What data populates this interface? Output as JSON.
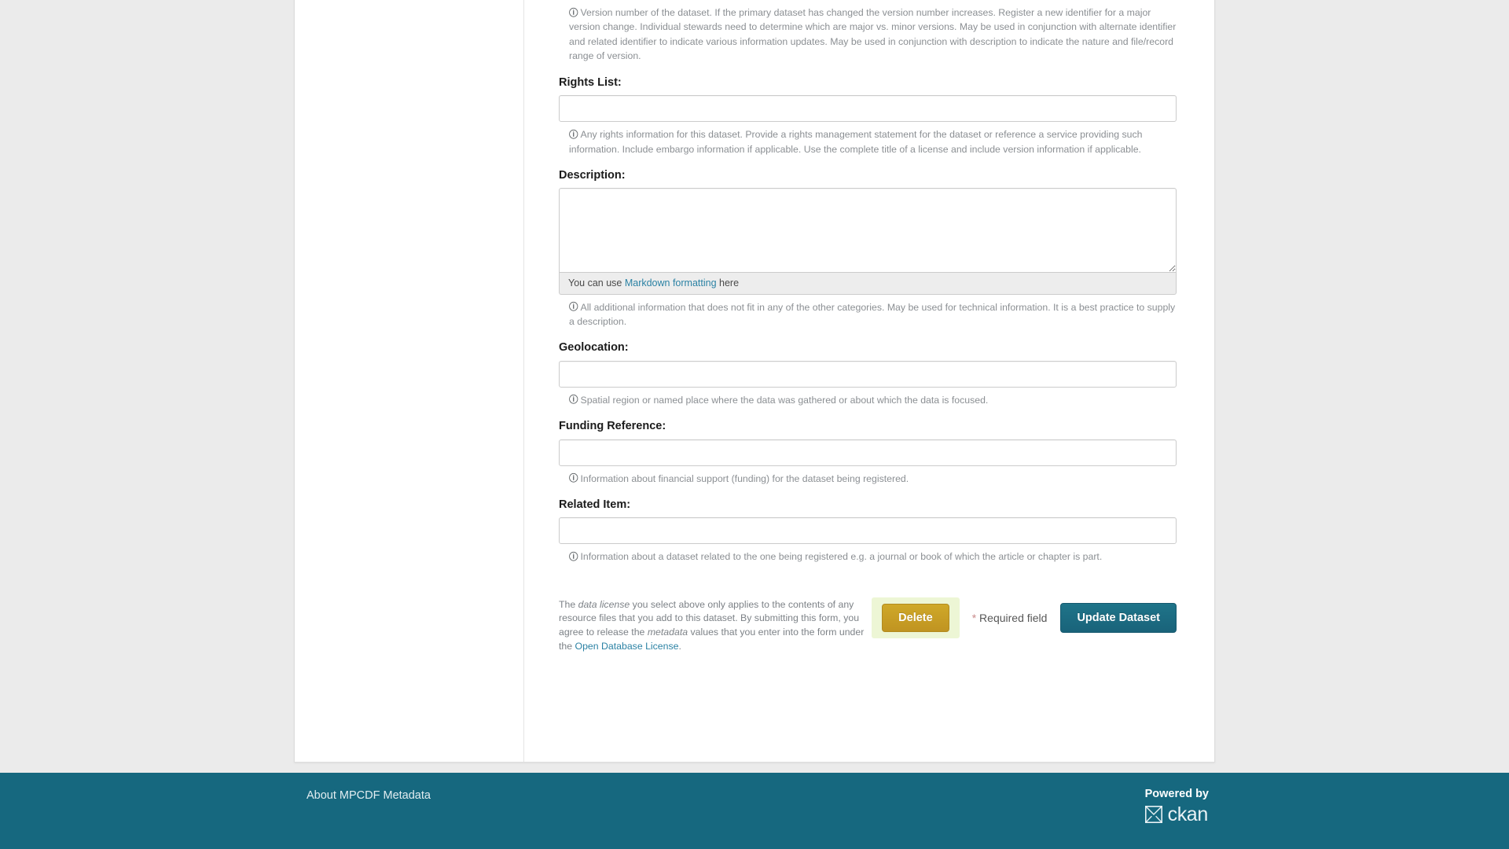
{
  "form": {
    "fields": [
      {
        "key": "version",
        "label": "",
        "value": "",
        "placeholder": "",
        "help": "Version number of the dataset. If the primary dataset has changed the version number increases. Register a new identifier for a major version change. Individual stewards need to determine which are major vs. minor versions. May be used in conjunction with alternate identifier and related identifier to indicate various information updates. May be used in conjunction with description to indicate the nature and file/record range of version."
      },
      {
        "key": "rights_list",
        "label": "Rights List:",
        "value": "",
        "placeholder": "",
        "help": "Any rights information for this dataset. Provide a rights management statement for the dataset or reference a service providing such information. Include embargo information if applicable. Use the complete title of a license and include version information if applicable."
      },
      {
        "key": "description",
        "label": "Description:",
        "value": "",
        "placeholder": "",
        "help": "All additional information that does not fit in any of the other categories. May be used for technical information. It is a best practice to supply a description."
      },
      {
        "key": "geolocation",
        "label": "Geolocation:",
        "value": "",
        "placeholder": "",
        "help": "Spatial region or named place where the data was gathered or about which the data is focused."
      },
      {
        "key": "funding_reference",
        "label": "Funding Reference:",
        "value": "",
        "placeholder": "",
        "help": "Information about financial support (funding) for the dataset being registered."
      },
      {
        "key": "related_item",
        "label": "Related Item:",
        "value": "",
        "placeholder": "",
        "help": "Information about a dataset related to the one being registered e.g. a journal or book of which the article or chapter is part."
      }
    ],
    "editor_info": {
      "prefix": "You can use ",
      "link": "Markdown formatting",
      "suffix": " here"
    },
    "info_icon": "ⓘ"
  },
  "actions": {
    "license_note": {
      "part1": "The ",
      "em1": "data license",
      "part2": " you select above only applies to the contents of any resource files that you add to this dataset. By submitting this form, you agree to release the ",
      "em2": "metadata",
      "part3": " values that you enter into the form under the ",
      "link": "Open Database License",
      "part4": "."
    },
    "delete_label": "Delete",
    "required_star": "*",
    "required_label": "Required field",
    "update_label": "Update Dataset"
  },
  "footer": {
    "about_link": "About MPCDF Metadata",
    "powered_by": "Powered by",
    "ckan_word": "ckan"
  },
  "colors": {
    "footer_bg": "#16687f",
    "primary_button": "#1b6c84",
    "danger_button": "#c9a227",
    "delete_highlight": "#edf6d5",
    "link": "#2b82a4",
    "page_bg": "#ebebeb"
  }
}
